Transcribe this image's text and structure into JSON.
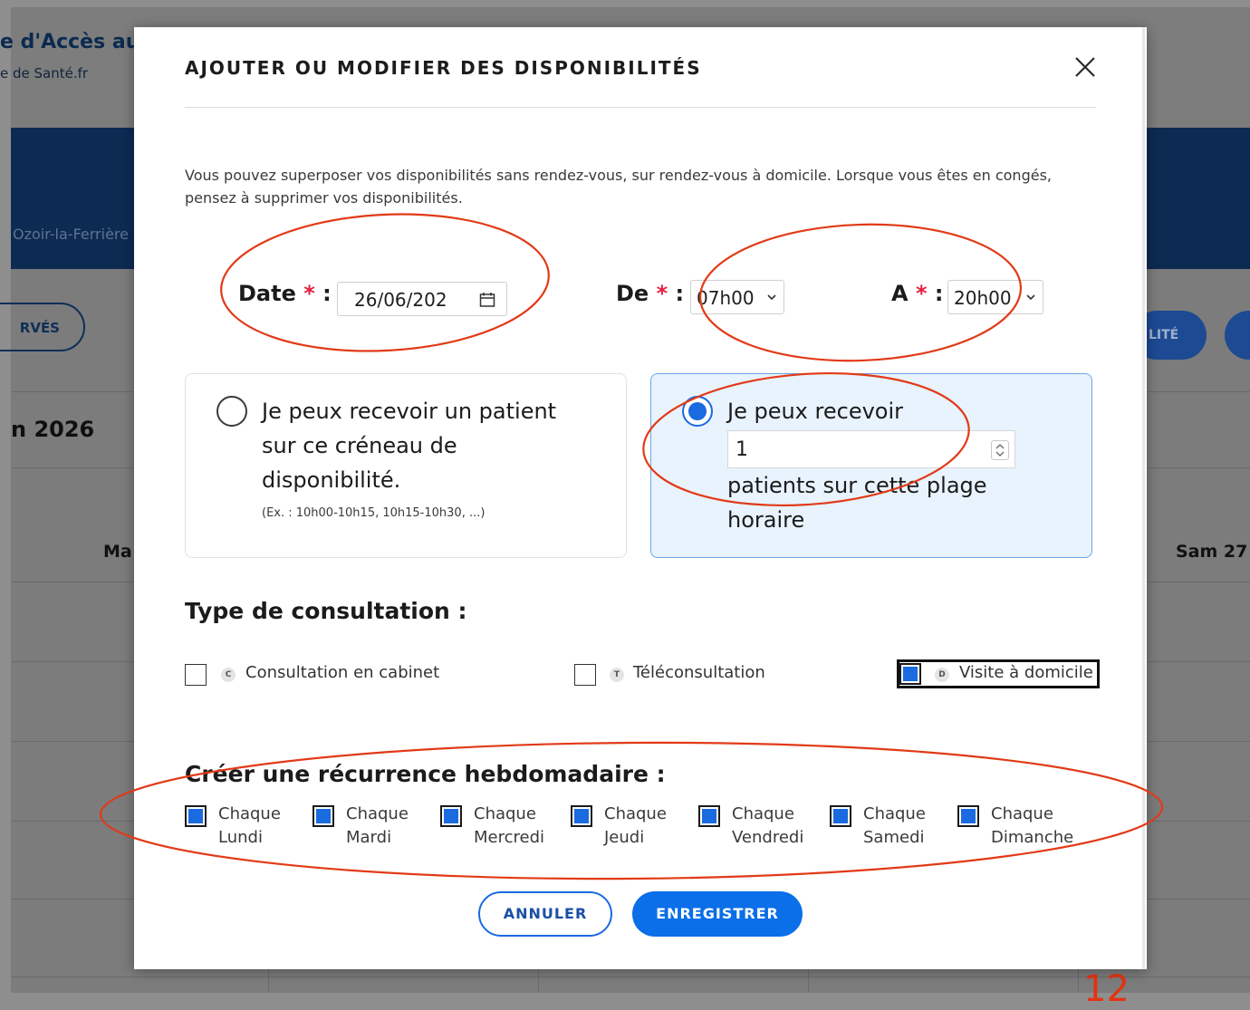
{
  "background": {
    "app_title": "e d'Accès au",
    "app_subtitle": "e de Santé.fr",
    "city": "Ozoir-la-Ferrière",
    "right_pill": "LITÉ",
    "reserved_button": "RVÉS",
    "month": "n 2026",
    "day_left": "Ma",
    "day_right": "Sam 27",
    "page_number": "12"
  },
  "modal": {
    "title": "AJOUTER OU MODIFIER DES DISPONIBILITÉS",
    "intro": "Vous pouvez superposer vos disponibilités sans rendez-vous, sur rendez-vous à domicile. Lorsque vous êtes en congés, pensez à supprimer vos disponibilités.",
    "date": {
      "label": "Date",
      "value": "26/06/202"
    },
    "from": {
      "label": "De",
      "value": "07h00"
    },
    "to": {
      "label": "A",
      "value": "20h00"
    },
    "required_mark": "*",
    "colon": ":",
    "option_single": {
      "text": "Je peux recevoir un patient sur ce créneau de disponibilité.",
      "example": "(Ex. : 10h00-10h15, 10h15-10h30, ...)",
      "selected": false
    },
    "option_multi": {
      "text_before": "Je peux recevoir",
      "count": "1",
      "text_after": "patients sur cette plage horaire",
      "selected": true
    },
    "consultation_title": "Type de consultation :",
    "consultation_types": [
      {
        "badge": "C",
        "label": "Consultation en cabinet",
        "checked": false
      },
      {
        "badge": "T",
        "label": "Téléconsultation",
        "checked": false
      },
      {
        "badge": "D",
        "label": "Visite à domicile",
        "checked": true
      }
    ],
    "recurrence_title": "Créer une récurrence hebdomadaire :",
    "recurrence_days": [
      {
        "line1": "Chaque",
        "line2": "Lundi",
        "checked": true
      },
      {
        "line1": "Chaque",
        "line2": "Mardi",
        "checked": true
      },
      {
        "line1": "Chaque",
        "line2": "Mercredi",
        "checked": true
      },
      {
        "line1": "Chaque",
        "line2": "Jeudi",
        "checked": true
      },
      {
        "line1": "Chaque",
        "line2": "Vendredi",
        "checked": true
      },
      {
        "line1": "Chaque",
        "line2": "Samedi",
        "checked": true
      },
      {
        "line1": "Chaque",
        "line2": "Dimanche",
        "checked": true
      }
    ],
    "cancel_label": "ANNULER",
    "save_label": "ENREGISTRER"
  },
  "colors": {
    "accent": "#0a6fe8",
    "required": "#e0213f",
    "annotation": "#e23a17",
    "banner": "#0d2a52"
  }
}
